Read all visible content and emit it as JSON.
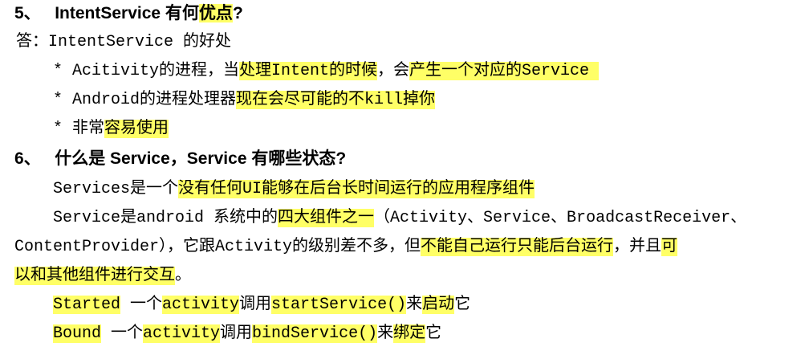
{
  "colors": {
    "highlight": "#ffff66",
    "text": "#000000",
    "background": "#ffffff"
  },
  "doc": {
    "q5": {
      "number": "5、",
      "prefix": "IntentService 有何",
      "highlight": "优点",
      "suffix": "?"
    },
    "a5": {
      "label": "答：",
      "text": "IntentService 的好处"
    },
    "b1": {
      "pre": "* Acitivity的进程，当",
      "hl1": "处理Intent的时候",
      "mid": "，会",
      "hl2": "产生一个对应的Service "
    },
    "b2": {
      "pre": "* Android的进程处理器",
      "hl": "现在会尽可能的不kill掉你"
    },
    "b3": {
      "pre": "* 非常",
      "hl": "容易使用"
    },
    "q6": {
      "number": "6、",
      "text": "什么是 Service，Service 有哪些状态?"
    },
    "p1": {
      "pre": "Services是一个",
      "hl": "没有任何UI能够在后台长时间运行的应用程序组件"
    },
    "p2": {
      "pre": "Service是android 系统中的",
      "hl": "四大组件之一",
      "post": "（Activity、Service、BroadcastReceiver、"
    },
    "p3": {
      "pre": "ContentProvider），它跟Activity的级别差不多，但",
      "hl1": "不能自己运行只能后台运行",
      "mid": "，并且",
      "hl2": "可"
    },
    "p4": {
      "hl": "以和其他组件进行交互",
      "post": "。"
    },
    "s1": {
      "hl1": "Started",
      "mid1": " 一个",
      "hl2": "activity",
      "mid2": "调用",
      "hl3": "startService()",
      "mid3": "来",
      "hl4": "启动",
      "post": "它"
    },
    "s2": {
      "hl1": "Bound",
      "mid1": " 一个",
      "hl2": "activity",
      "mid2": "调用",
      "hl3": "bindService()",
      "mid3": "来",
      "hl4": "绑定",
      "post": "它"
    }
  }
}
